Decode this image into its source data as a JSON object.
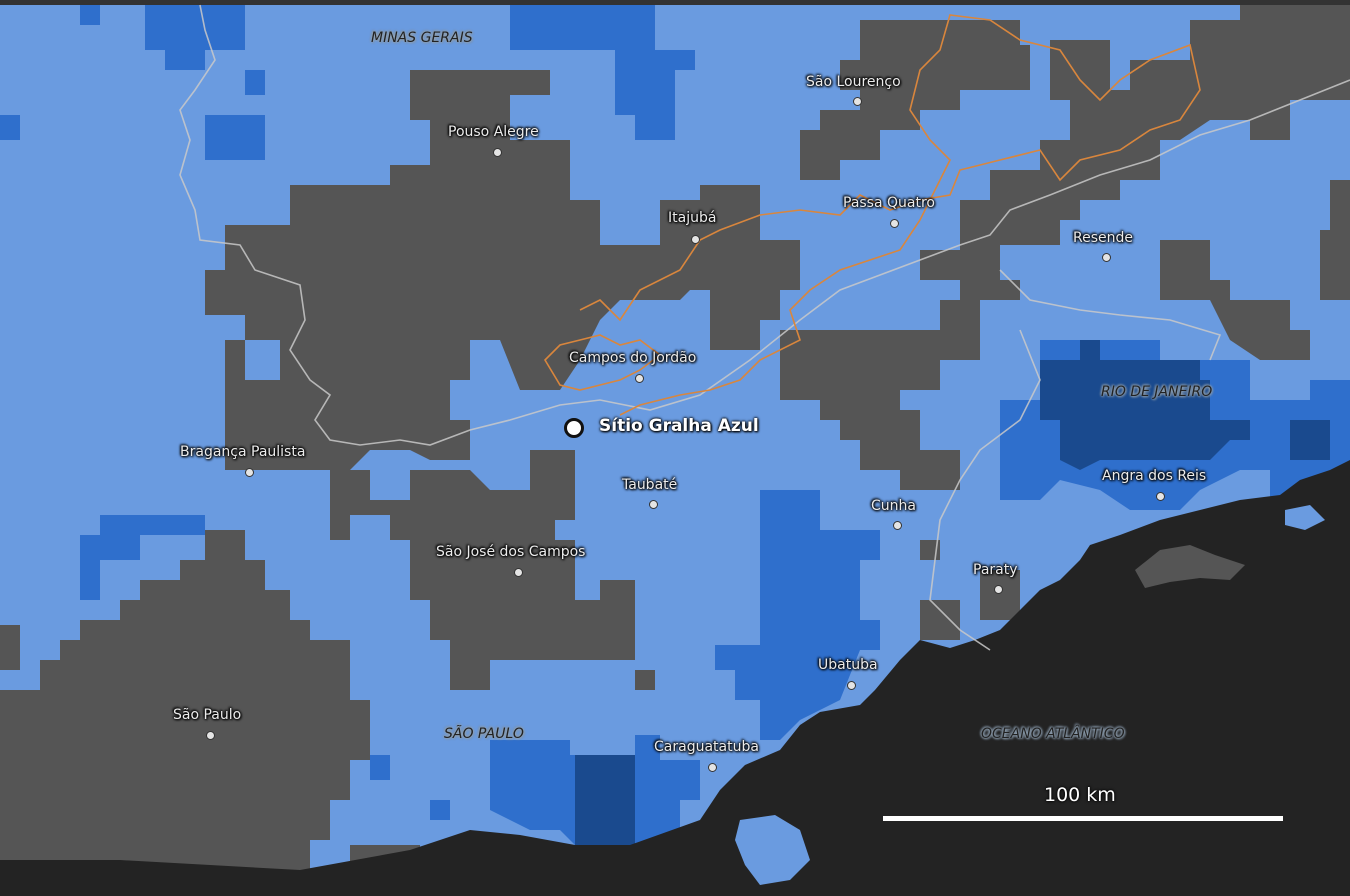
{
  "map": {
    "colors": {
      "ocean": "#232323",
      "land": "#555555",
      "precip_light": "#6a9be0",
      "precip_medium": "#2f6fcc",
      "precip_dark": "#1a4a8e",
      "state_border": "#c9c9c9",
      "park_border": "#d9863d"
    },
    "regions": {
      "minas_gerais": "MINAS GERAIS",
      "sao_paulo": "SÃO PAULO",
      "rio_de_janeiro": "RIO DE JANEIRO",
      "oceano": "OCEANO ATLÂNTICO"
    },
    "cities": {
      "sao_lourenco": "São Lourenço",
      "pouso_alegre": "Pouso Alegre",
      "itajuba": "Itajubá",
      "passa_quatro": "Passa Quatro",
      "resende": "Resende",
      "campos_do_jordao": "Campos do Jordão",
      "braganca_paulista": "Bragança Paulista",
      "taubate": "Taubaté",
      "cunha": "Cunha",
      "angra_dos_reis": "Angra dos Reis",
      "sao_jose_dos_campos": "São José dos Campos",
      "paraty": "Paraty",
      "ubatuba": "Ubatuba",
      "sao_paulo": "São Paulo",
      "caraguatatuba": "Caraguatatuba"
    },
    "site": {
      "name": "Sítio Gralha Azul"
    },
    "scale": {
      "label": "100 km"
    }
  }
}
